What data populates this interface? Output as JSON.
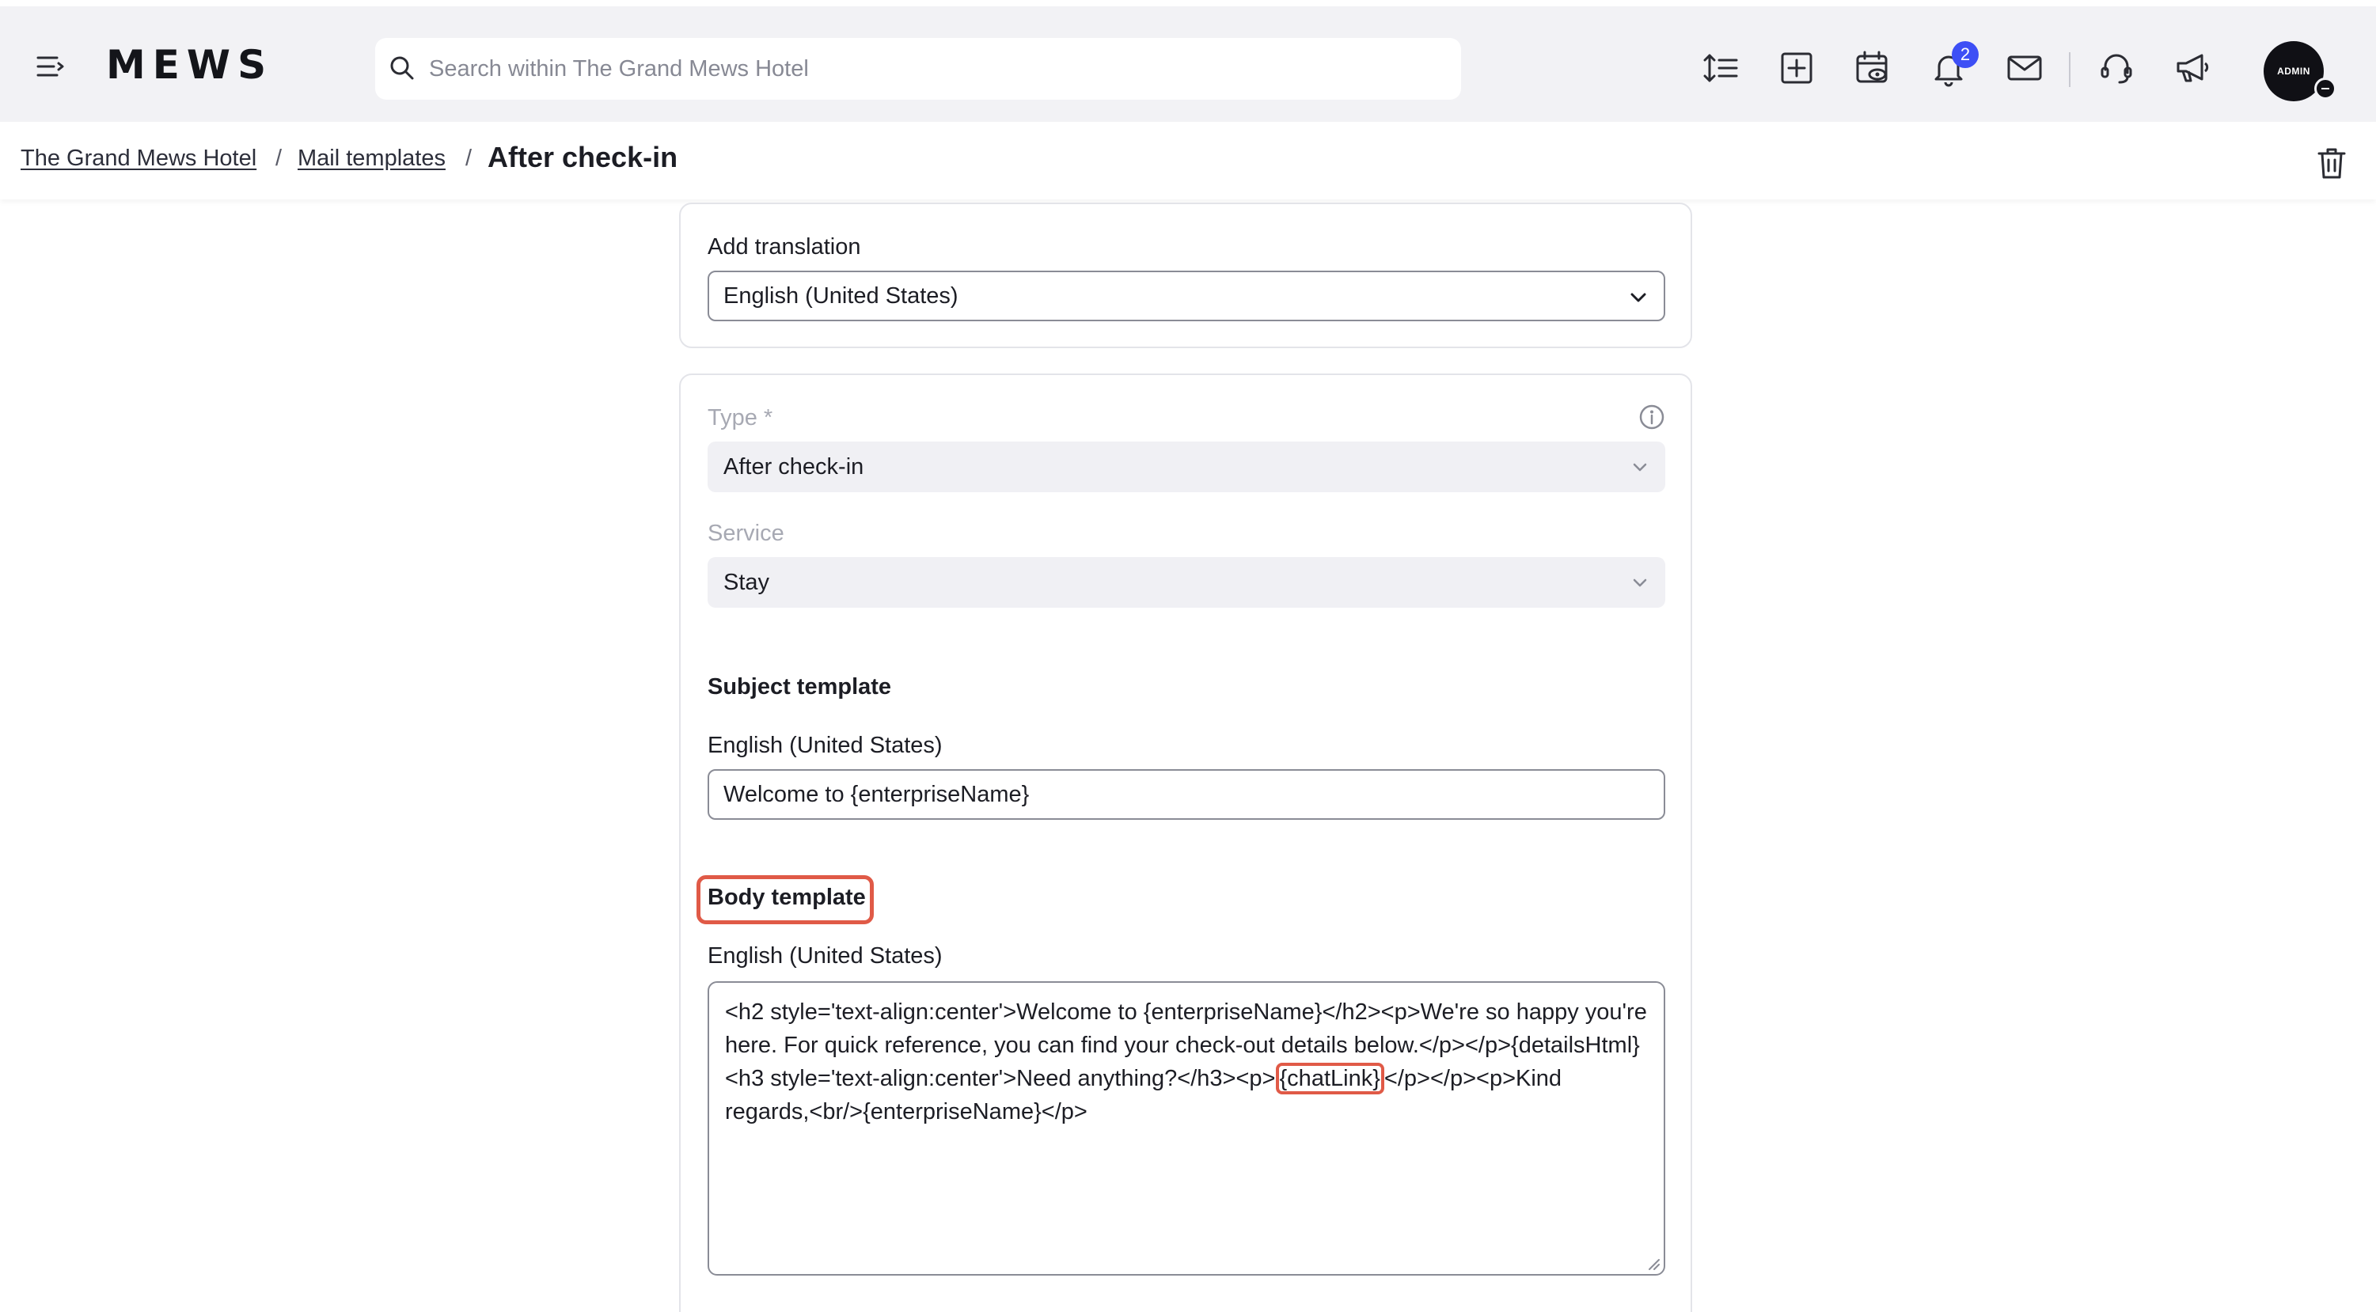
{
  "app": {
    "logo": "MEWS"
  },
  "search": {
    "placeholder": "Search within The Grand Mews Hotel"
  },
  "notifications": {
    "count": "2"
  },
  "user": {
    "avatar_text": "ADMIN"
  },
  "breadcrumb": {
    "items": [
      {
        "label": "The Grand Mews Hotel"
      },
      {
        "label": "Mail templates"
      }
    ],
    "separator": "/",
    "current": "After check-in"
  },
  "translation_card": {
    "label": "Add translation",
    "selected": "English (United States)"
  },
  "details_card": {
    "type_label": "Type *",
    "type_value": "After check-in",
    "service_label": "Service",
    "service_value": "Stay",
    "subject": {
      "title": "Subject template",
      "language_label": "English (United States)",
      "value": "Welcome to {enterpriseName}"
    },
    "body": {
      "title": "Body template",
      "language_label": "English (United States)",
      "part1": "<h2 style='text-align:center'>Welcome to {enterpriseName}</h2><p>We're so happy you're here. For quick reference, you can find your check-out details below.</p></p>{detailsHtml}<h3 style='text-align:center'>Need anything?</h3><p>",
      "highlight": "{chatLink}",
      "part2": "</p></p><p>Kind regards,<br/>{enterpriseName}</p>"
    }
  },
  "colors": {
    "accent_badge": "#3d4ff5",
    "highlight": "#e05a47",
    "topbar_bg": "#f2f2f5"
  }
}
